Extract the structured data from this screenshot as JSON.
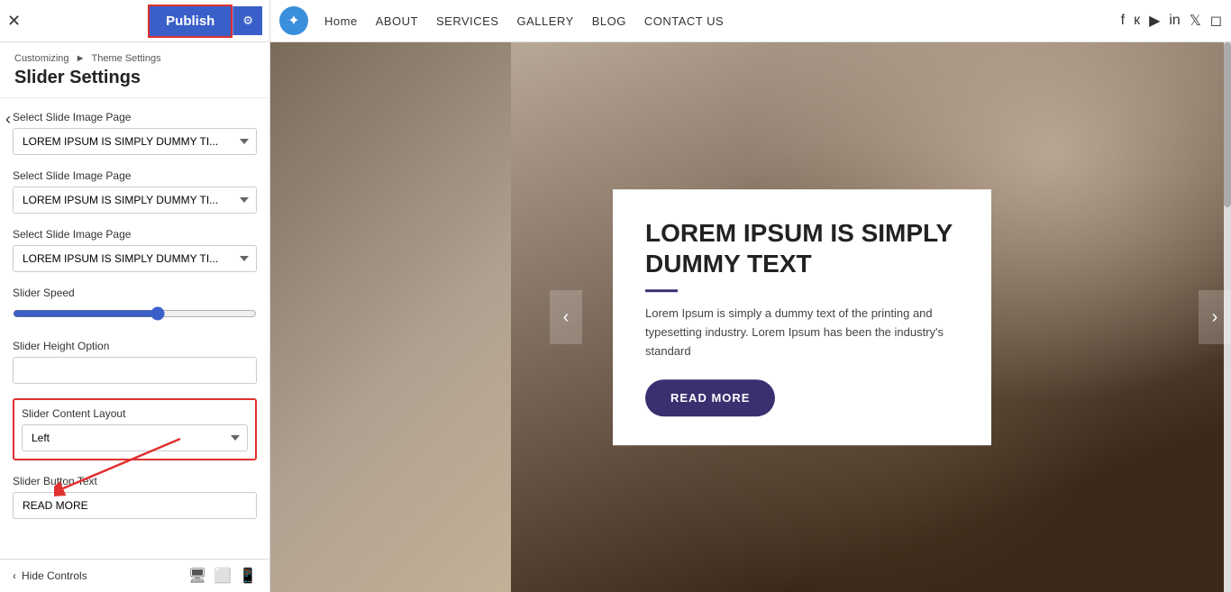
{
  "topbar": {
    "close_label": "✕",
    "publish_label": "Publish",
    "gear_label": "⚙",
    "logo_icon": "✦",
    "nav_links": [
      {
        "label": "Home"
      },
      {
        "label": "ABOUT"
      },
      {
        "label": "SERVICES"
      },
      {
        "label": "GALLERY"
      },
      {
        "label": "BLOG"
      },
      {
        "label": "CONTACT US"
      }
    ],
    "social_icons": [
      "f",
      "к",
      "▶",
      "in",
      "🐦",
      "📷"
    ]
  },
  "sidebar": {
    "breadcrumb_part1": "Customizing",
    "breadcrumb_sep": "►",
    "breadcrumb_part2": "Theme Settings",
    "page_title": "Slider Settings",
    "back_icon": "‹",
    "fields": [
      {
        "id": "slide1",
        "label": "Select Slide Image Page",
        "type": "select",
        "value": "LOREM IPSUM IS SIMPLY DUMMY TI...",
        "options": [
          "LOREM IPSUM IS SIMPLY DUMMY TI..."
        ]
      },
      {
        "id": "slide2",
        "label": "Select Slide Image Page",
        "type": "select",
        "value": "LOREM IPSUM IS SIMPLY DUMMY TI...",
        "options": [
          "LOREM IPSUM IS SIMPLY DUMMY TI..."
        ]
      },
      {
        "id": "slide3",
        "label": "Select Slide Image Page",
        "type": "select",
        "value": "LOREM IPSUM IS SIMPLY DUMMY TI...",
        "options": [
          "LOREM IPSUM IS SIMPLY DUMMY TI..."
        ]
      }
    ],
    "slider_speed_label": "Slider Speed",
    "slider_speed_value": 60,
    "slider_height_label": "Slider Height Option",
    "slider_height_value": "",
    "slider_content_layout_label": "Slider Content Layout",
    "slider_content_layout_value": "Left",
    "slider_button_text_label": "Slider Button Text",
    "slider_button_text_value": "READ MORE",
    "hide_controls_label": "Hide Controls"
  },
  "hero": {
    "title": "LOREM IPSUM IS SIMPLY DUMMY TEXT",
    "body": "Lorem Ipsum is simply a dummy text of the printing and typesetting industry. Lorem Ipsum has been the industry's standard",
    "button_label": "READ MORE"
  }
}
